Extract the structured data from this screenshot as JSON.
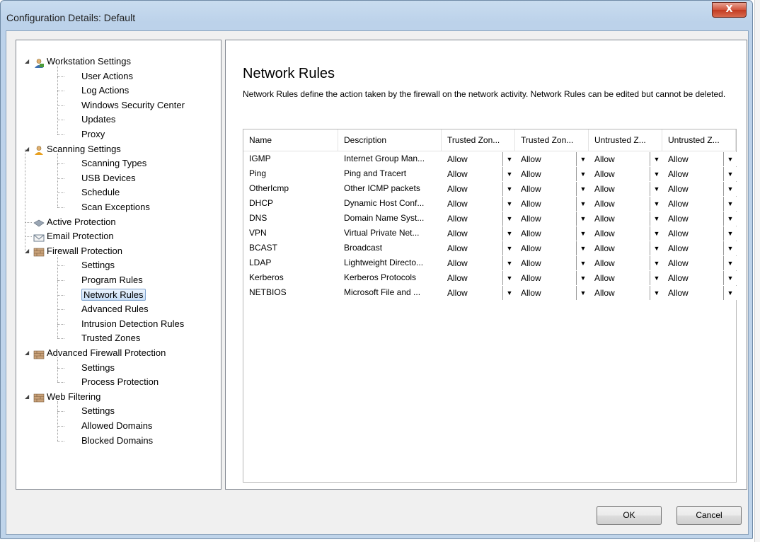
{
  "window": {
    "title": "Configuration Details: Default",
    "close_label": "X"
  },
  "tree": [
    {
      "label": "Workstation Settings",
      "level": 0,
      "icon": "workstation-icon",
      "expanded": true
    },
    {
      "label": "User Actions",
      "level": 1
    },
    {
      "label": "Log Actions",
      "level": 1
    },
    {
      "label": "Windows Security Center",
      "level": 1
    },
    {
      "label": "Updates",
      "level": 1
    },
    {
      "label": "Proxy",
      "level": 1
    },
    {
      "label": "Scanning Settings",
      "level": 0,
      "icon": "scanning-icon",
      "expanded": true
    },
    {
      "label": "Scanning Types",
      "level": 1
    },
    {
      "label": "USB Devices",
      "level": 1
    },
    {
      "label": "Schedule",
      "level": 1
    },
    {
      "label": "Scan Exceptions",
      "level": 1
    },
    {
      "label": "Active Protection",
      "level": 0,
      "icon": "active-protection-icon"
    },
    {
      "label": "Email Protection",
      "level": 0,
      "icon": "email-icon"
    },
    {
      "label": "Firewall Protection",
      "level": 0,
      "icon": "firewall-icon",
      "expanded": true
    },
    {
      "label": "Settings",
      "level": 1
    },
    {
      "label": "Program Rules",
      "level": 1
    },
    {
      "label": "Network Rules",
      "level": 1,
      "selected": true
    },
    {
      "label": "Advanced Rules",
      "level": 1
    },
    {
      "label": "Intrusion Detection Rules",
      "level": 1
    },
    {
      "label": "Trusted Zones",
      "level": 1
    },
    {
      "label": "Advanced Firewall Protection",
      "level": 0,
      "icon": "firewall-icon",
      "expanded": true
    },
    {
      "label": "Settings",
      "level": 1
    },
    {
      "label": "Process Protection",
      "level": 1
    },
    {
      "label": "Web Filtering",
      "level": 0,
      "icon": "firewall-icon",
      "expanded": true
    },
    {
      "label": "Settings",
      "level": 1
    },
    {
      "label": "Allowed Domains",
      "level": 1
    },
    {
      "label": "Blocked Domains",
      "level": 1
    }
  ],
  "main": {
    "heading": "Network Rules",
    "description": "Network Rules define the action taken by the firewall on the network activity. Network Rules can be edited but cannot be deleted.",
    "columns": [
      "Name",
      "Description",
      "Trusted Zon...",
      "Trusted Zon...",
      "Untrusted Z...",
      "Untrusted Z..."
    ],
    "rows": [
      {
        "name": "IGMP",
        "description": "Internet Group Man...",
        "values": [
          "Allow",
          "Allow",
          "Allow",
          "Allow"
        ]
      },
      {
        "name": "Ping",
        "description": "Ping and Tracert",
        "values": [
          "Allow",
          "Allow",
          "Allow",
          "Allow"
        ]
      },
      {
        "name": "OtherIcmp",
        "description": "Other ICMP packets",
        "values": [
          "Allow",
          "Allow",
          "Allow",
          "Allow"
        ]
      },
      {
        "name": "DHCP",
        "description": "Dynamic Host Conf...",
        "values": [
          "Allow",
          "Allow",
          "Allow",
          "Allow"
        ]
      },
      {
        "name": "DNS",
        "description": "Domain Name Syst...",
        "values": [
          "Allow",
          "Allow",
          "Allow",
          "Allow"
        ]
      },
      {
        "name": "VPN",
        "description": "Virtual Private Net...",
        "values": [
          "Allow",
          "Allow",
          "Allow",
          "Allow"
        ]
      },
      {
        "name": "BCAST",
        "description": "Broadcast",
        "values": [
          "Allow",
          "Allow",
          "Allow",
          "Allow"
        ]
      },
      {
        "name": "LDAP",
        "description": "Lightweight Directo...",
        "values": [
          "Allow",
          "Allow",
          "Allow",
          "Allow"
        ]
      },
      {
        "name": "Kerberos",
        "description": "Kerberos Protocols",
        "values": [
          "Allow",
          "Allow",
          "Allow",
          "Allow"
        ]
      },
      {
        "name": "NETBIOS",
        "description": "Microsoft File and ...",
        "values": [
          "Allow",
          "Allow",
          "Allow",
          "Allow"
        ]
      }
    ]
  },
  "buttons": {
    "ok": "OK",
    "cancel": "Cancel"
  },
  "colors": {
    "selection": "#c7def7",
    "window_frame": "#bfd4ea"
  }
}
